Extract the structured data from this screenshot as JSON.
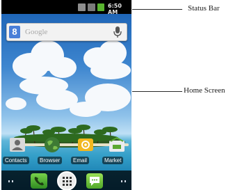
{
  "status_bar": {
    "time": "6:50 AM",
    "icons": [
      "usb-icon",
      "sd-card-icon",
      "battery-icon"
    ]
  },
  "search_widget": {
    "logo_letter": "8",
    "placeholder": "Google",
    "mic_icon": "mic-icon"
  },
  "dock": {
    "apps": [
      {
        "label": "Contacts",
        "icon": "contacts-icon"
      },
      {
        "label": "Browser",
        "icon": "globe-icon"
      },
      {
        "label": "Email",
        "icon": "email-icon"
      },
      {
        "label": "Market",
        "icon": "market-icon"
      }
    ]
  },
  "bottom_bar": {
    "icons": [
      "phone-icon",
      "app-launcher-icon",
      "messaging-icon"
    ]
  },
  "annotations": {
    "status_bar_label": "Status Bar",
    "home_screen_label": "Home Screen"
  },
  "colors": {
    "status_bar": "#000000",
    "sky": "#3e86cf",
    "label_bg": "#1f1f1f"
  }
}
